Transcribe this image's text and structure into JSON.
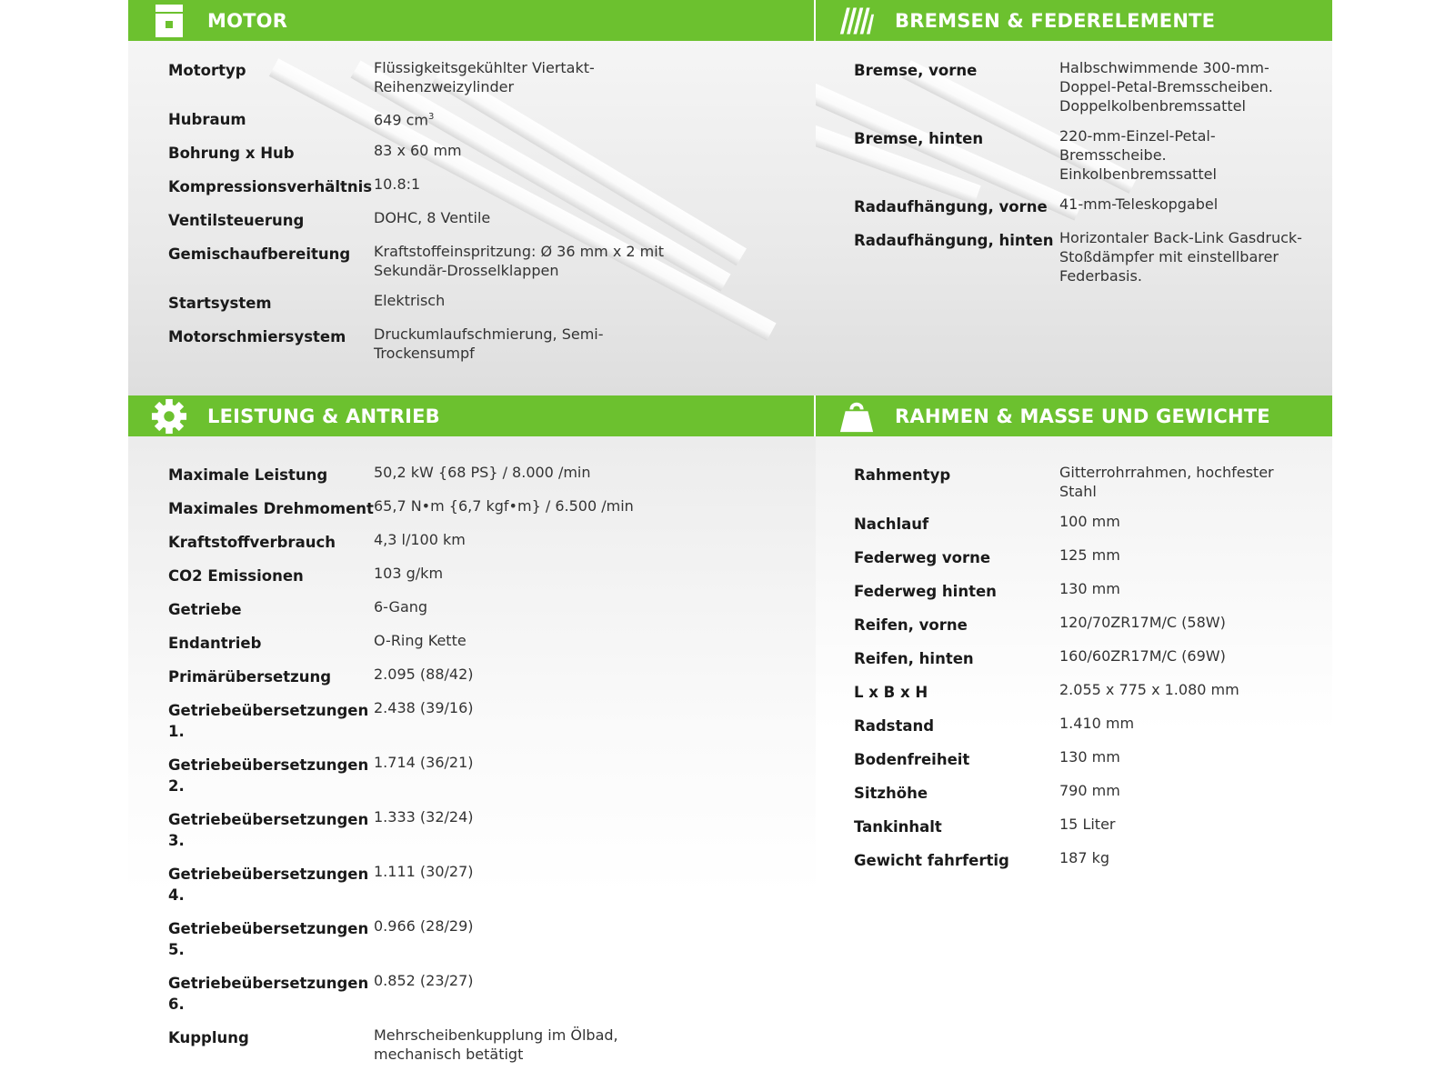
{
  "sections": {
    "motor": {
      "title": "MOTOR",
      "icon": "piston-icon",
      "rows": [
        {
          "label": "Motortyp",
          "value": "Flüssigkeitsgekühlter Viertakt-Reihenzweizylinder"
        },
        {
          "label": "Hubraum",
          "value": "649 cm",
          "sup": "3"
        },
        {
          "label": "Bohrung x Hub",
          "value": "83 x 60 mm"
        },
        {
          "label": "Kompressionsverhältnis",
          "value": "10.8:1"
        },
        {
          "label": "Ventilsteuerung",
          "value": "DOHC, 8 Ventile"
        },
        {
          "label": "Gemischaufbereitung",
          "value": "Kraftstoffeinspritzung: Ø 36 mm x 2 mit Sekundär-Drosselklappen"
        },
        {
          "label": "Startsystem",
          "value": "Elektrisch"
        },
        {
          "label": "Motorschmiersystem",
          "value": "Druckumlaufschmierung, Semi-Trockensumpf"
        }
      ]
    },
    "brakes": {
      "title": "BREMSEN & FEDERELEMENTE",
      "icon": "suspension-icon",
      "rows": [
        {
          "label": "Bremse, vorne",
          "value": "Halbschwimmende 300-mm-Doppel-Petal-Bremsscheiben. Doppelkolbenbremssattel"
        },
        {
          "label": "Bremse, hinten",
          "value": "220-mm-Einzel-Petal-Bremsscheibe. Einkolbenbremssattel"
        },
        {
          "label": "Radaufhängung, vorne",
          "value": "41-mm-Teleskopgabel"
        },
        {
          "label": "Radaufhängung, hinten",
          "value": "Horizontaler Back-Link Gasdruck-Stoßdämpfer mit einstellbarer Federbasis."
        }
      ]
    },
    "performance": {
      "title": "LEISTUNG & ANTRIEB",
      "icon": "gear-icon",
      "rows": [
        {
          "label": "Maximale Leistung",
          "value": "50,2 kW {68 PS} / 8.000 /min"
        },
        {
          "label": "Maximales Drehmoment",
          "value": "65,7 N•m {6,7 kgf•m} / 6.500 /min"
        },
        {
          "label": "Kraftstoffverbrauch",
          "value": "4,3 l/100 km"
        },
        {
          "label": "CO2 Emissionen",
          "value": "103 g/km"
        },
        {
          "label": "Getriebe",
          "value": "6-Gang"
        },
        {
          "label": "Endantrieb",
          "value": "O-Ring Kette"
        },
        {
          "label": "Primärübersetzung",
          "value": "2.095 (88/42)"
        },
        {
          "label": "Getriebeübersetzungen 1.",
          "value": "2.438 (39/16)"
        },
        {
          "label": "Getriebeübersetzungen 2.",
          "value": "1.714 (36/21)"
        },
        {
          "label": "Getriebeübersetzungen 3.",
          "value": "1.333 (32/24)"
        },
        {
          "label": "Getriebeübersetzungen 4.",
          "value": "1.111 (30/27)"
        },
        {
          "label": "Getriebeübersetzungen 5.",
          "value": "0.966 (28/29)"
        },
        {
          "label": "Getriebeübersetzungen 6.",
          "value": "0.852 (23/27)"
        },
        {
          "label": "Kupplung",
          "value": "Mehrscheibenkupplung im Ölbad, mechanisch betätigt"
        }
      ]
    },
    "frame": {
      "title": "RAHMEN & MASSE UND GEWICHTE",
      "icon": "weight-icon",
      "rows": [
        {
          "label": "Rahmentyp",
          "value": "Gitterrohrrahmen, hochfester Stahl"
        },
        {
          "label": "Nachlauf",
          "value": "100 mm"
        },
        {
          "label": "Federweg vorne",
          "value": "125 mm"
        },
        {
          "label": "Federweg hinten",
          "value": "130 mm"
        },
        {
          "label": "Reifen, vorne",
          "value": "120/70ZR17M/C (58W)"
        },
        {
          "label": "Reifen, hinten",
          "value": "160/60ZR17M/C (69W)"
        },
        {
          "label": "L x B x H",
          "value": "2.055 x 775 x 1.080 mm"
        },
        {
          "label": "Radstand",
          "value": "1.410 mm"
        },
        {
          "label": "Bodenfreiheit",
          "value": "130 mm"
        },
        {
          "label": "Sitzhöhe",
          "value": "790 mm"
        },
        {
          "label": "Tankinhalt",
          "value": "15 Liter"
        },
        {
          "label": "Gewicht fahrfertig",
          "value": "187 kg"
        }
      ]
    }
  },
  "colors": {
    "accent": "#6cc12f",
    "header_text": "#ffffff"
  }
}
